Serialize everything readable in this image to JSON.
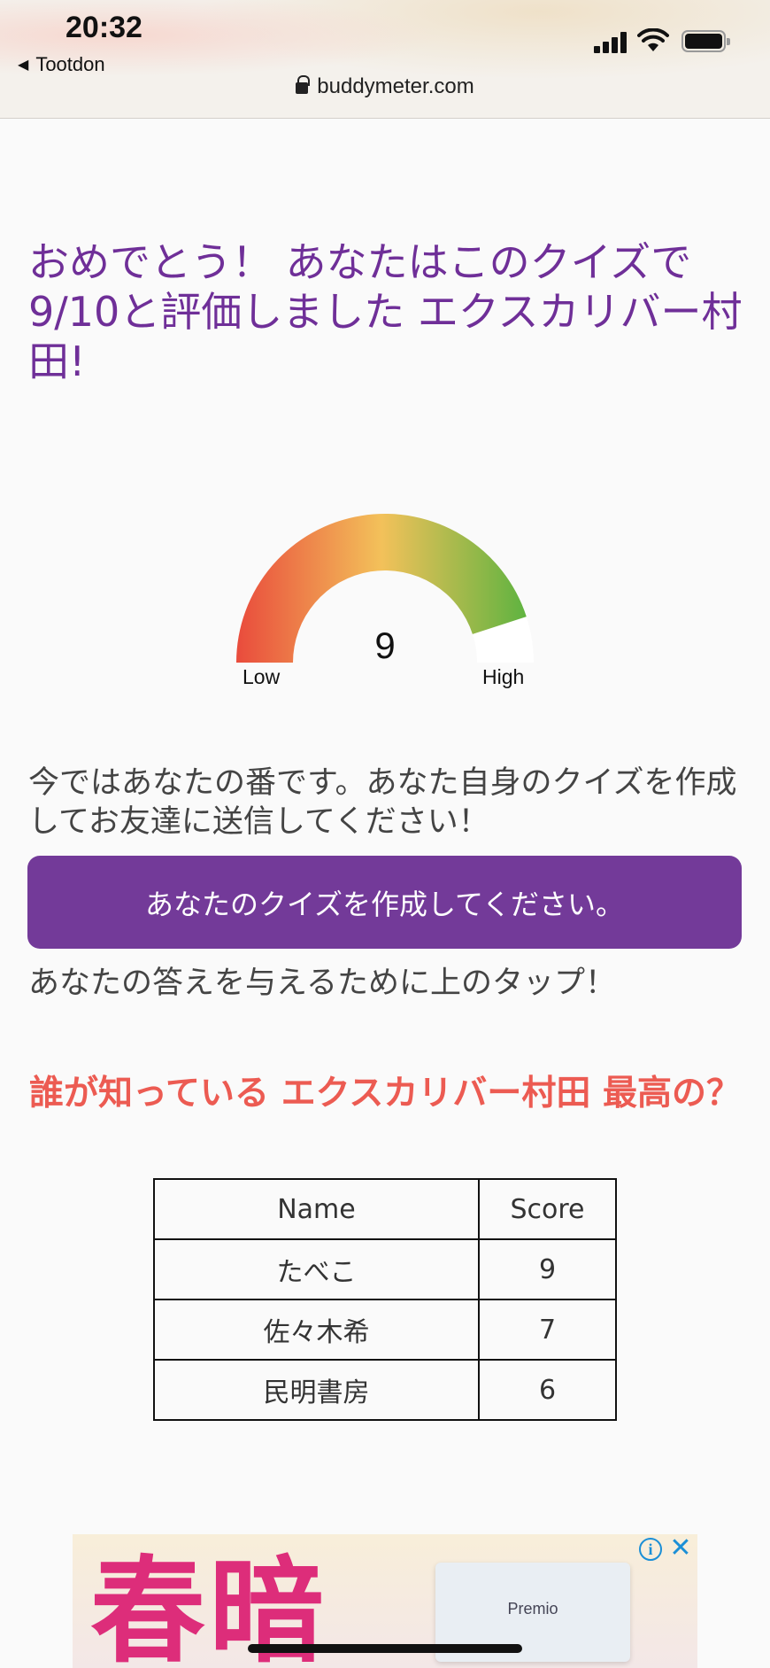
{
  "status_bar": {
    "time": "20:32",
    "back_label": "Tootdon"
  },
  "browser": {
    "url": "buddymeter.com"
  },
  "result": {
    "headline": "おめでとう！ あなたはこのクイズで 9/10と評価しました エクスカリバー村田!"
  },
  "gauge": {
    "value": "9",
    "low_label": "Low",
    "high_label": "High",
    "fraction": 0.9
  },
  "cta": {
    "prompt": "今ではあなたの番です。あなた自身のクイズを作成してお友達に送信してください！",
    "button_label": "あなたのクイズを作成してください。",
    "hint": "あなたの答えを与えるために上のタップ！"
  },
  "leaderboard": {
    "title": "誰が知っている エクスカリバー村田 最高の？",
    "headers": [
      "Name",
      "Score"
    ],
    "rows": [
      {
        "name": "たべこ",
        "score": "9"
      },
      {
        "name": "佐々木希",
        "score": "7"
      },
      {
        "name": "民明書房",
        "score": "6"
      }
    ]
  },
  "ad": {
    "headline_text": "春暗",
    "product_name": "Premio"
  },
  "colors": {
    "accent": "#733a99",
    "heading": "#6f2f98",
    "leaderboard_title": "#ec5b52"
  }
}
